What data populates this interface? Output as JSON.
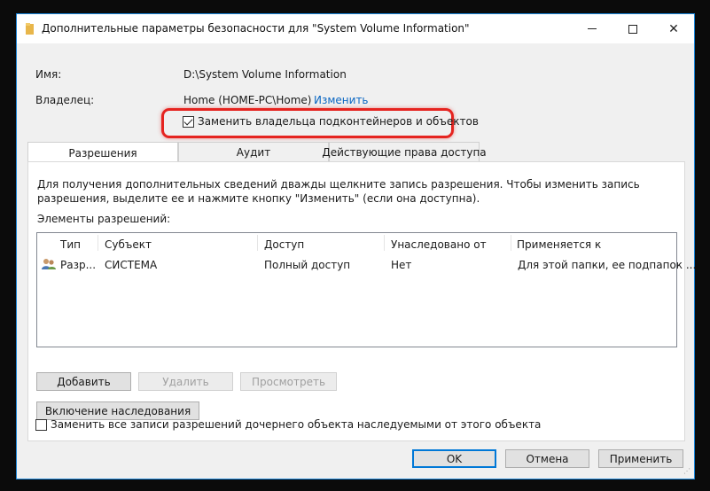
{
  "window": {
    "title": "Дополнительные параметры безопасности  для \"System Volume Information\"",
    "minimize": "—",
    "close": "✕"
  },
  "info": {
    "name_label": "Имя:",
    "name_value": "D:\\System Volume Information",
    "owner_label": "Владелец:",
    "owner_value": "Home (HOME-PC\\Home)",
    "change_link": "Изменить",
    "replace_owner_label": "Заменить владельца подконтейнеров и объектов",
    "replace_owner_checked": true
  },
  "tabs": [
    {
      "label": "Разрешения",
      "active": true
    },
    {
      "label": "Аудит",
      "active": false
    },
    {
      "label": "Действующие права доступа",
      "active": false
    }
  ],
  "permissions": {
    "description": "Для получения дополнительных сведений дважды щелкните запись разрешения. Чтобы изменить запись разрешения, выделите ее и нажмите кнопку \"Изменить\" (если она доступна).",
    "entries_label": "Элементы разрешений:",
    "columns": [
      "Тип",
      "Субъект",
      "Доступ",
      "Унаследовано от",
      "Применяется к"
    ],
    "rows": [
      {
        "type": "Разр...",
        "subject": "СИСТЕМА",
        "access": "Полный доступ",
        "inherited": "Нет",
        "applies": "Для этой папки, ее подпапок ..."
      }
    ],
    "add_button": "Добавить",
    "remove_button": "Удалить",
    "view_button": "Просмотреть",
    "inheritance_button": "Включение наследования",
    "replace_child_label": "Заменить все записи разрешений дочернего объекта наследуемыми от этого объекта",
    "replace_child_checked": false
  },
  "footer": {
    "ok": "OK",
    "cancel": "Отмена",
    "apply": "Применить"
  },
  "colors": {
    "accent": "#0078d7",
    "highlight": "#e52420",
    "link": "#0a66c2"
  }
}
